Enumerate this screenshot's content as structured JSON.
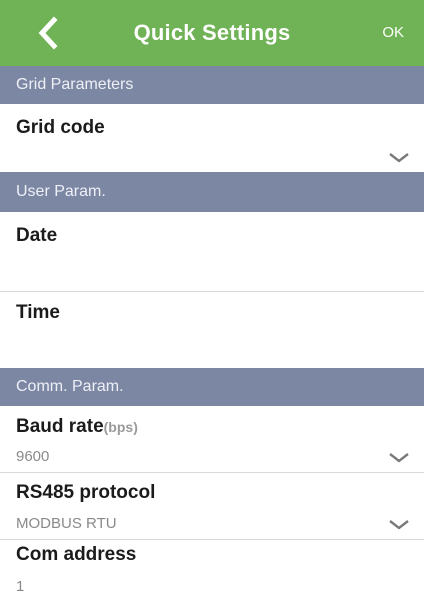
{
  "header": {
    "title": "Quick Settings",
    "ok_label": "OK",
    "color": "#70b256"
  },
  "sections": {
    "grid": {
      "label": "Grid Parameters",
      "grid_code": {
        "label": "Grid code",
        "value": ""
      }
    },
    "user": {
      "label": "User Param.",
      "date": {
        "label": "Date",
        "value": ""
      },
      "time": {
        "label": "Time",
        "value": ""
      }
    },
    "comm": {
      "label": "Comm. Param.",
      "baud_rate": {
        "label": "Baud rate",
        "unit": "(bps)",
        "value": "9600"
      },
      "rs485": {
        "label": "RS485 protocol",
        "value": "MODBUS RTU"
      },
      "com_address": {
        "label": "Com address",
        "value": "1"
      }
    }
  },
  "colors": {
    "section_header_bg": "#7c87a4",
    "section_header_text": "#eef0f6"
  },
  "icons": {
    "back": "chevron-left-icon",
    "dropdown": "chevron-down-icon"
  }
}
